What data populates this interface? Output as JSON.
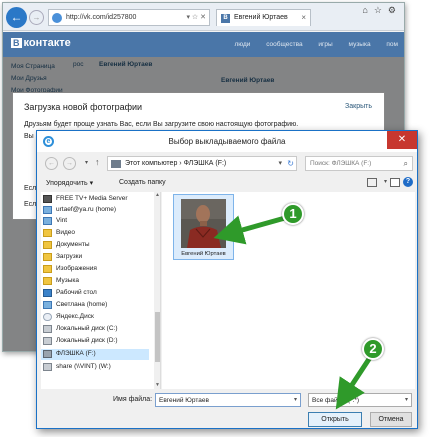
{
  "browser": {
    "address": "http://vk.com/id257800",
    "tab_title": "Евгений Юртаев",
    "address_tools": "▾ ☆ ✕",
    "back_icon": "arrow-left-icon",
    "forward_icon": "arrow-right-icon"
  },
  "vk": {
    "logo": "контакте",
    "logo_letter": "В",
    "menu": [
      "люди",
      "сообщества",
      "игры",
      "музыка",
      "пом"
    ],
    "left_nav": [
      "Моя Страница",
      "Мои Друзья",
      "Мои Фотографии"
    ],
    "ros": "рос",
    "center_name": "Евгений Юртаев",
    "right_name": "Евгений Юртаев"
  },
  "upload_dialog": {
    "title": "Загрузка новой фотографии",
    "close": "Закрыть",
    "text": "Друзьям будет проще узнать Вас, если Вы загрузите свою настоящую фотографию.",
    "line2": "Вы",
    "line3": "Есл",
    "line4": "Есл"
  },
  "file_dialog": {
    "title": "Выбор выкладываемого файла",
    "close_glyph": "✕",
    "path": "Этот компьютер › ФЛЭШКА (F:)",
    "search_placeholder": "Поиск: ФЛЭШКА (F:)",
    "organize": "Упорядочить ▾",
    "new_folder": "Создать папку",
    "tree": [
      {
        "label": "FREE TV+ Media Server",
        "icon": "media-server-icon"
      },
      {
        "label": "urtaef@ya.ru (home)",
        "icon": "user-folder-icon"
      },
      {
        "label": "Vint",
        "icon": "user-folder-icon"
      },
      {
        "label": "Видео",
        "icon": "folder-icon"
      },
      {
        "label": "Документы",
        "icon": "folder-icon"
      },
      {
        "label": "Загрузки",
        "icon": "folder-icon"
      },
      {
        "label": "Изображения",
        "icon": "folder-icon"
      },
      {
        "label": "Музыка",
        "icon": "folder-icon"
      },
      {
        "label": "Рабочий стол",
        "icon": "folder-icon"
      },
      {
        "label": "Светлана (home)",
        "icon": "user-folder-icon"
      },
      {
        "label": "Яндекс.Диск",
        "icon": "cloud-icon"
      },
      {
        "label": "Локальный диск (C:)",
        "icon": "drive-icon"
      },
      {
        "label": "Локальный диск (D:)",
        "icon": "drive-icon"
      },
      {
        "label": "ФЛЭШКА (F:)",
        "icon": "usb-drive-icon",
        "selected": true
      },
      {
        "label": "share (\\\\VINT) (W:)",
        "icon": "network-drive-icon"
      }
    ],
    "file": {
      "name": "Евгений Юртаев"
    },
    "filename_label": "Имя файла:",
    "filename_value": "Евгений Юртаев",
    "filetype_value": "Все файлы (*.*)",
    "open_button": "Открыть",
    "cancel_button": "Отмена"
  },
  "annotations": {
    "step1": "1",
    "step2": "2",
    "color": "#2f9a2a"
  }
}
